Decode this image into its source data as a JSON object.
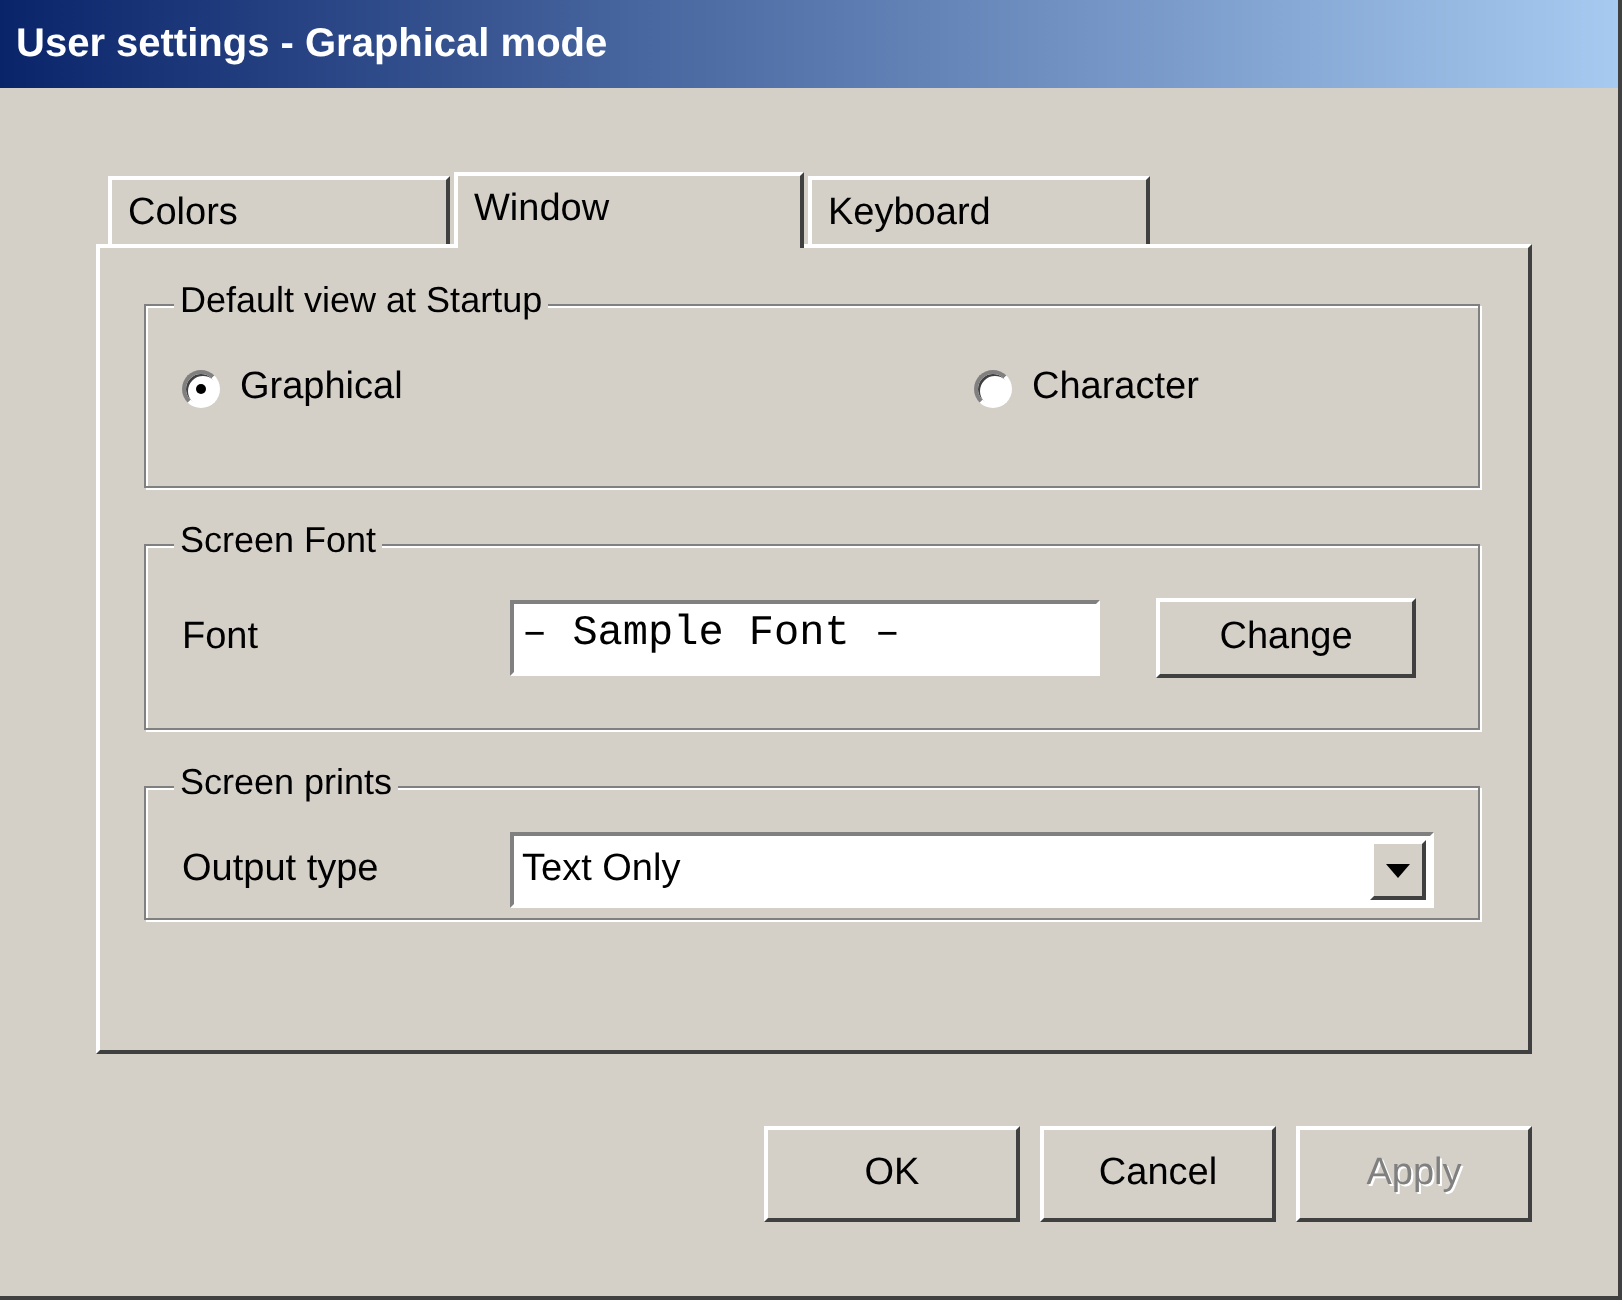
{
  "window": {
    "title": "User settings - Graphical mode"
  },
  "tabs": [
    {
      "label": "Colors",
      "selected": false
    },
    {
      "label": "Window",
      "selected": true
    },
    {
      "label": "Keyboard",
      "selected": false
    }
  ],
  "groups": [
    {
      "kind": "radios",
      "title": "Default view at Startup",
      "options": [
        {
          "label": "Graphical",
          "selected": true
        },
        {
          "label": "Character",
          "selected": false
        }
      ]
    },
    {
      "kind": "font",
      "title": "Screen Font",
      "label": "Font",
      "value": "– Sample Font –",
      "button": "Change"
    },
    {
      "kind": "select",
      "title": "Screen prints",
      "label": "Output type",
      "value": "Text Only"
    }
  ],
  "buttons": [
    {
      "label": "OK",
      "disabled": false
    },
    {
      "label": "Cancel",
      "disabled": false
    },
    {
      "label": "Apply",
      "disabled": true
    }
  ]
}
